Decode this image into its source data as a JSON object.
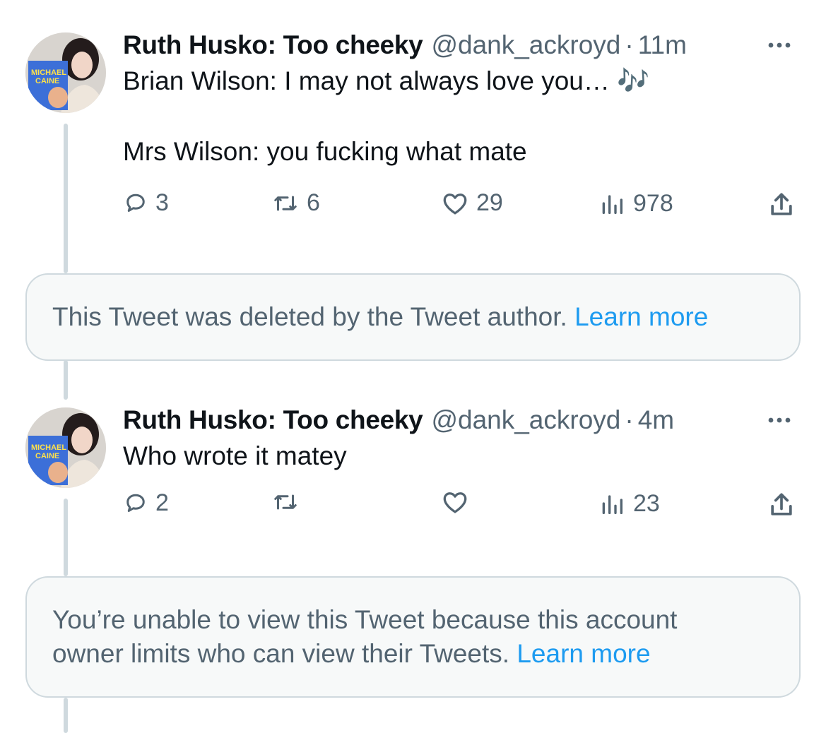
{
  "tweets": [
    {
      "name": "Ruth Husko: Too cheeky",
      "handle": "@dank_ackroyd",
      "separator": "·",
      "time": "11m",
      "line1": "Brian Wilson: I may not always love you… 🎶",
      "line2": "Mrs Wilson: you fucking what mate",
      "replies": "3",
      "retweets": "6",
      "likes": "29",
      "views": "978"
    },
    {
      "name": "Ruth Husko: Too cheeky",
      "handle": "@dank_ackroyd",
      "separator": "·",
      "time": "4m",
      "line1": "Who wrote it matey",
      "replies": "2",
      "retweets": "",
      "likes": "",
      "views": "23"
    }
  ],
  "notices": [
    {
      "text": "This Tweet was deleted by the Tweet author.",
      "link": "Learn more"
    },
    {
      "text": "You’re unable to view this Tweet because this account owner limits who can view their Tweets.",
      "link": "Learn more"
    }
  ],
  "avatar": {
    "magazine_text": "MICHAEL CAINE"
  },
  "colors": {
    "text": "#0f1419",
    "muted": "#536471",
    "link": "#1d9bf0",
    "border": "#cfd9de",
    "panel": "#f7f9f9"
  },
  "icons": [
    "more-icon",
    "reply-icon",
    "retweet-icon",
    "like-icon",
    "views-icon",
    "share-icon"
  ]
}
